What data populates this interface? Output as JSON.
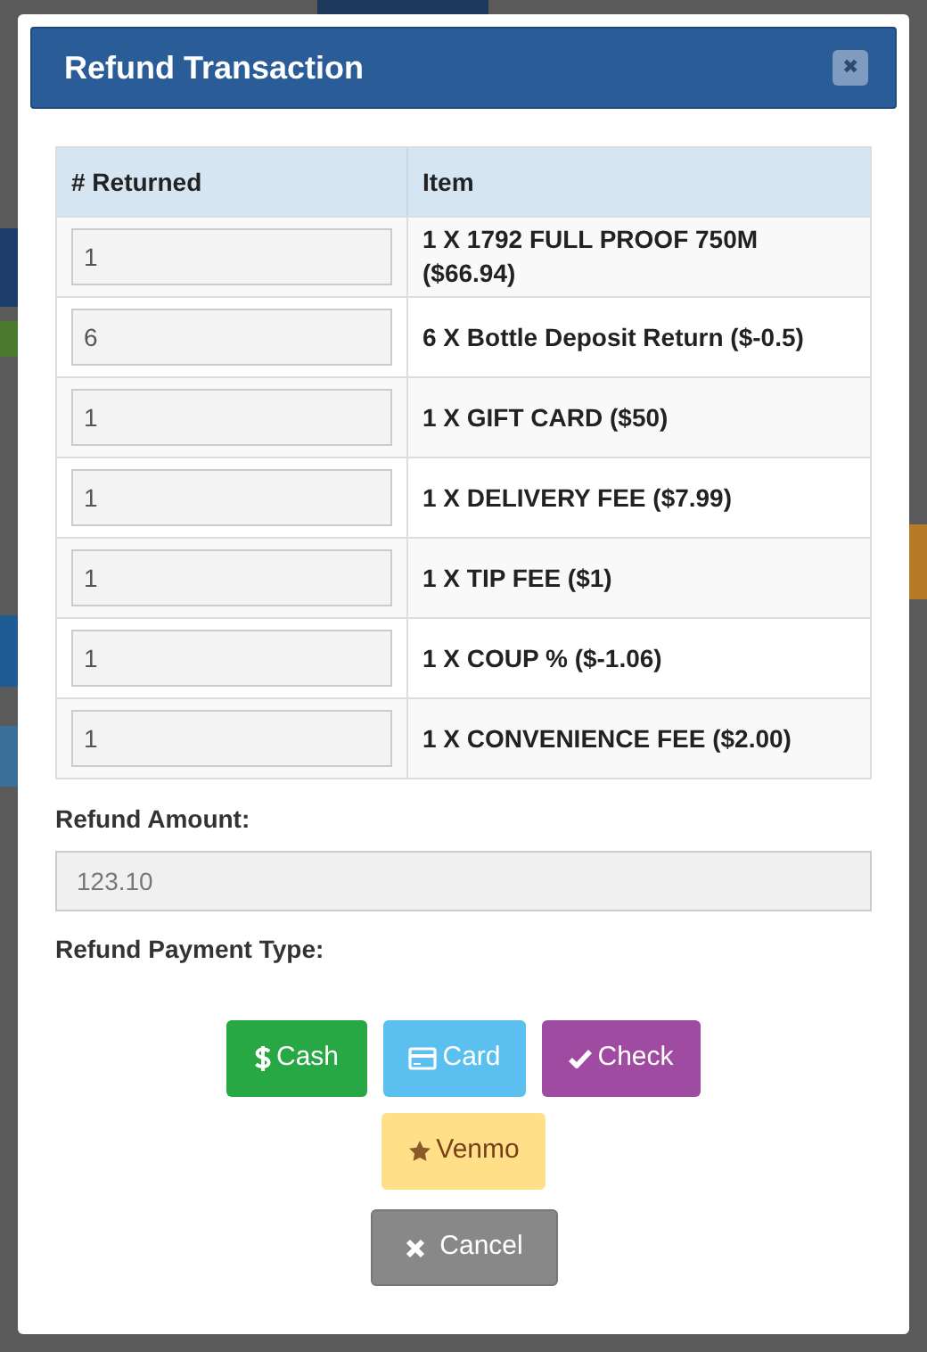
{
  "dialog": {
    "title": "Refund Transaction",
    "close": "✖"
  },
  "table": {
    "columns": [
      "# Returned",
      "Item"
    ],
    "rows": [
      {
        "returned": "1",
        "item": "1 X 1792 FULL PROOF 750M ($66.94)"
      },
      {
        "returned": "6",
        "item": "6 X Bottle Deposit Return ($-0.5)"
      },
      {
        "returned": "1",
        "item": "1 X GIFT CARD ($50)"
      },
      {
        "returned": "1",
        "item": "1 X DELIVERY FEE ($7.99)"
      },
      {
        "returned": "1",
        "item": "1 X TIP FEE ($1)"
      },
      {
        "returned": "1",
        "item": "1 X COUP % ($-1.06)"
      },
      {
        "returned": "1",
        "item": "1 X CONVENIENCE FEE ($2.00)"
      }
    ]
  },
  "refund_amount": {
    "label": "Refund Amount:",
    "value": "123.10"
  },
  "payment_type": {
    "label": "Refund Payment Type:",
    "buttons": [
      {
        "kind": "cash",
        "label": "Cash"
      },
      {
        "kind": "card",
        "label": "Card"
      },
      {
        "kind": "check",
        "label": "Check"
      },
      {
        "kind": "venmo",
        "label": "Venmo"
      }
    ]
  },
  "cancel": {
    "label": "Cancel"
  }
}
